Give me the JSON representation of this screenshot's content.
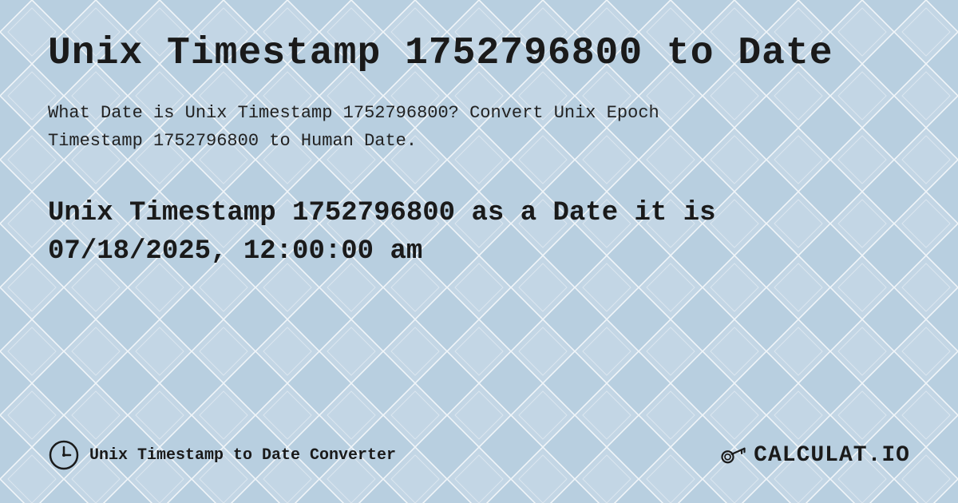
{
  "page": {
    "title": "Unix Timestamp 1752796800 to Date",
    "description_part1": "What Date is Unix Timestamp 1752796800? Convert Unix Epoch",
    "description_part2": "Timestamp 1752796800 to Human Date.",
    "result_line1": "Unix Timestamp 1752796800 as a Date it is",
    "result_line2": "07/18/2025, 12:00:00 am",
    "footer_label": "Unix Timestamp to Date Converter",
    "logo_text": "CALCULAT.IO",
    "background_color": "#c8d8e8",
    "accent_color": "#1a1a1a"
  }
}
